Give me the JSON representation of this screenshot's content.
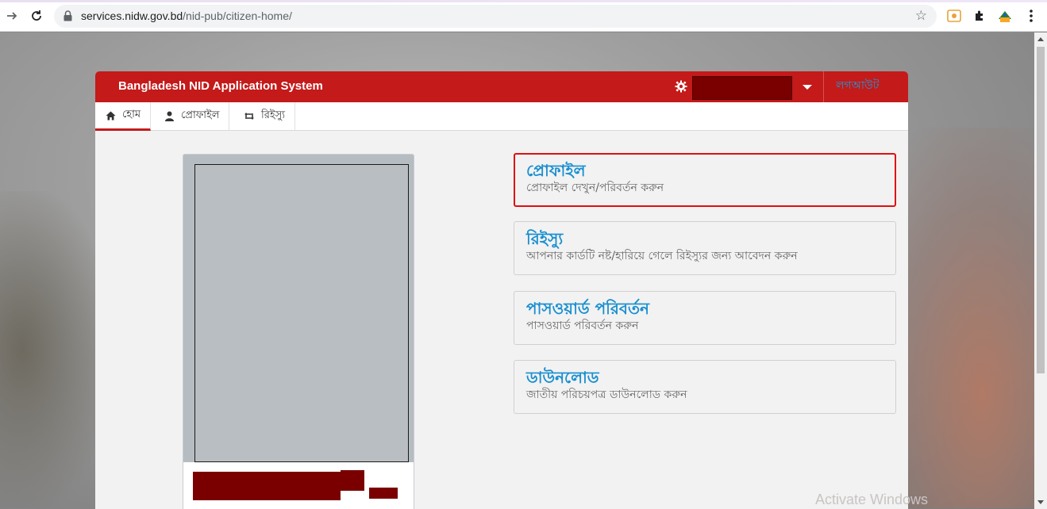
{
  "browser": {
    "url_host": "services.nidw.gov.bd",
    "url_path": "/nid-pub/citizen-home/"
  },
  "app": {
    "brand": "Bangladesh NID Application System",
    "logout_label": "লগআউট",
    "tabs": [
      {
        "label": "হোম",
        "icon": "home-icon"
      },
      {
        "label": "প্রোফাইল",
        "icon": "user-icon"
      },
      {
        "label": "রিইস্যু",
        "icon": "retweet-icon"
      }
    ],
    "cards": [
      {
        "title": "প্রোফাইল",
        "desc": "প্রোফাইল দেখুন/পরিবর্তন করুন"
      },
      {
        "title": "রিইস্যু",
        "desc": "আপনার কার্ডটি নষ্ট/হারিয়ে গেলে রিইস্যুর জন্য আবেদন করুন"
      },
      {
        "title": "পাসওয়ার্ড পরিবর্তন",
        "desc": "পাসওয়ার্ড পরিবর্তন করুন"
      },
      {
        "title": "ডাউনলোড",
        "desc": "জাতীয় পরিচয়পত্র ডাউনলোড করুন"
      }
    ]
  },
  "os": {
    "watermark": "Activate Windows"
  },
  "colors": {
    "header_red": "#c41a1a",
    "link_blue": "#1a8fd0",
    "highlight_border": "#e01010"
  }
}
